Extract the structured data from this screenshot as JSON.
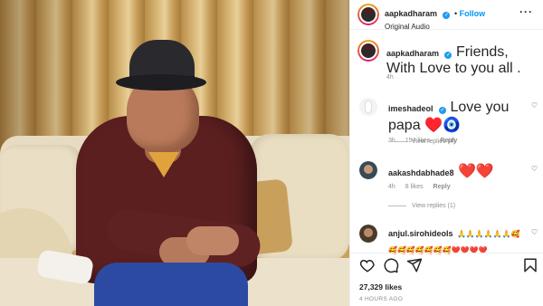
{
  "post": {
    "author": "aapkadharam",
    "follow_label": "Follow",
    "audio": "Original Audio",
    "caption": "Friends, With Love to you all .",
    "caption_time": "4h"
  },
  "comments": [
    {
      "user": "imeshadeol",
      "text": "Love you papa ♥️🧿",
      "time": "3h",
      "likes": "154 likes",
      "reply": "Reply",
      "view_replies": "View replies (4)"
    },
    {
      "user": "aakashdabhade8",
      "text": "❤️❤️",
      "time": "4h",
      "likes": "8 likes",
      "reply": "Reply",
      "view_replies": "View replies (1)"
    },
    {
      "user": "anjul.sirohideols",
      "text": "🙏🙏🙏🙏🙏🙏🥰🥰🥰🥰🥰🥰🥰🥰❤️❤️❤️❤️"
    }
  ],
  "footer": {
    "likes": "27,329 likes",
    "posted": "4 HOURS AGO"
  },
  "colors": {
    "accent": "#0095f6",
    "verified": "#1f9bf0",
    "muted": "#8e8e8e",
    "heart_red": "#ed4956"
  },
  "icons": [
    "verified-badge-icon",
    "more-options-icon",
    "heart-icon",
    "comment-icon",
    "share-icon",
    "bookmark-icon"
  ]
}
